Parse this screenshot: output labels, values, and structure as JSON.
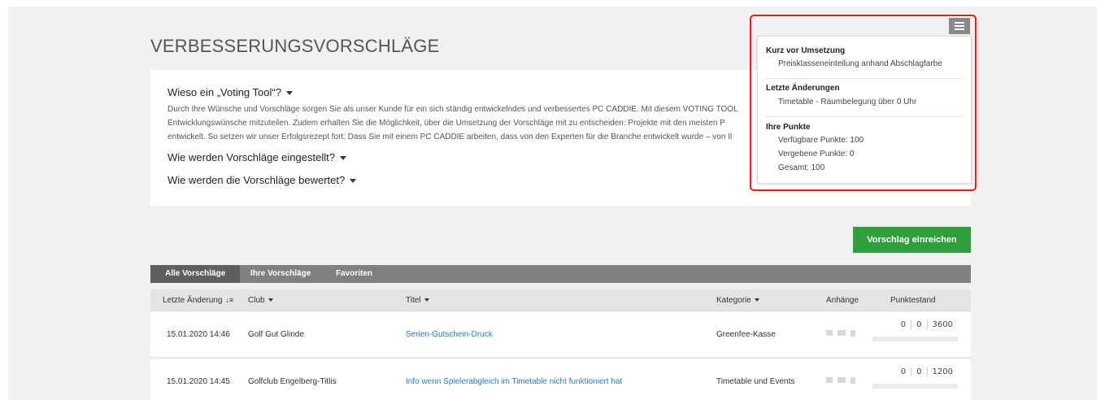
{
  "page": {
    "title": "VERBESSERUNGSVORSCHLÄGE"
  },
  "info": {
    "q1": "Wieso ein „Voting Tool“?",
    "line1": "Durch Ihre Wünsche und Vorschläge sorgen Sie als unser Kunde für ein sich ständig entwickelndes und verbessertes PC CADDIE. Mit diesem VOTING TOOL",
    "line2": "Entwicklungswünsche mitzuteilen. Zudem erhalten Sie die Möglichkeit, über die Umsetzung der Vorschläge mit zu entscheiden: Projekte mit den meisten P",
    "line3": "entwickelt. So setzen wir unser Erfolgsrezept fort: Dass Sie mit einem PC CADDIE arbeiten, dass von den Experten für die Branche entwickelt wurde – von Il",
    "q2": "Wie werden Vorschläge eingestellt?",
    "q3": "Wie werden die Vorschläge bewertet?"
  },
  "actions": {
    "submit": "Vorschlag einreichen"
  },
  "tabs": [
    {
      "label": "Alle Vorschläge",
      "active": true
    },
    {
      "label": "Ihre Vorschläge",
      "active": false
    },
    {
      "label": "Favoriten",
      "active": false
    }
  ],
  "table": {
    "headers": {
      "date": "Letzte Änderung",
      "club": "Club",
      "title": "Titel",
      "category": "Kategorie",
      "attachments": "Anhänge",
      "score": "Punktestand"
    },
    "rows": [
      {
        "date": "15.01.2020 14:46",
        "club": "Golf Gut Glinde",
        "title": "Serien-Gutschein-Druck",
        "category": "Greenfee-Kasse",
        "s1": "0",
        "s2": "0",
        "s3": "3600"
      },
      {
        "date": "15.01.2020 14:45",
        "club": "Golfclub Engelberg-Titlis",
        "title": "Info wenn Spielerabgleich im Timetable nicht funktioniert hat",
        "category": "Timetable und Events",
        "s1": "0",
        "s2": "0",
        "s3": "1200"
      }
    ]
  },
  "popover": {
    "section1_title": "Kurz vor Umsetzung",
    "section1_item": "Preisklasseneinteilung anhand Abschlagfarbe",
    "section2_title": "Letzte Änderungen",
    "section2_item": "Timetable - Raumbelegung über 0 Uhr",
    "section3_title": "Ihre Punkte",
    "available": "Verfügbare Punkte: 100",
    "given": "Vergebene Punkte: 0",
    "total": "Gesamt: 100"
  },
  "icons": {
    "menu": "hamburger-icon",
    "sort": "sort-icon",
    "image": "image-icon",
    "video": "video-icon",
    "document": "document-icon"
  },
  "colors": {
    "accent_green": "#2f9e3c",
    "link_blue": "#2a7bbf",
    "highlight_red": "#e02020"
  }
}
